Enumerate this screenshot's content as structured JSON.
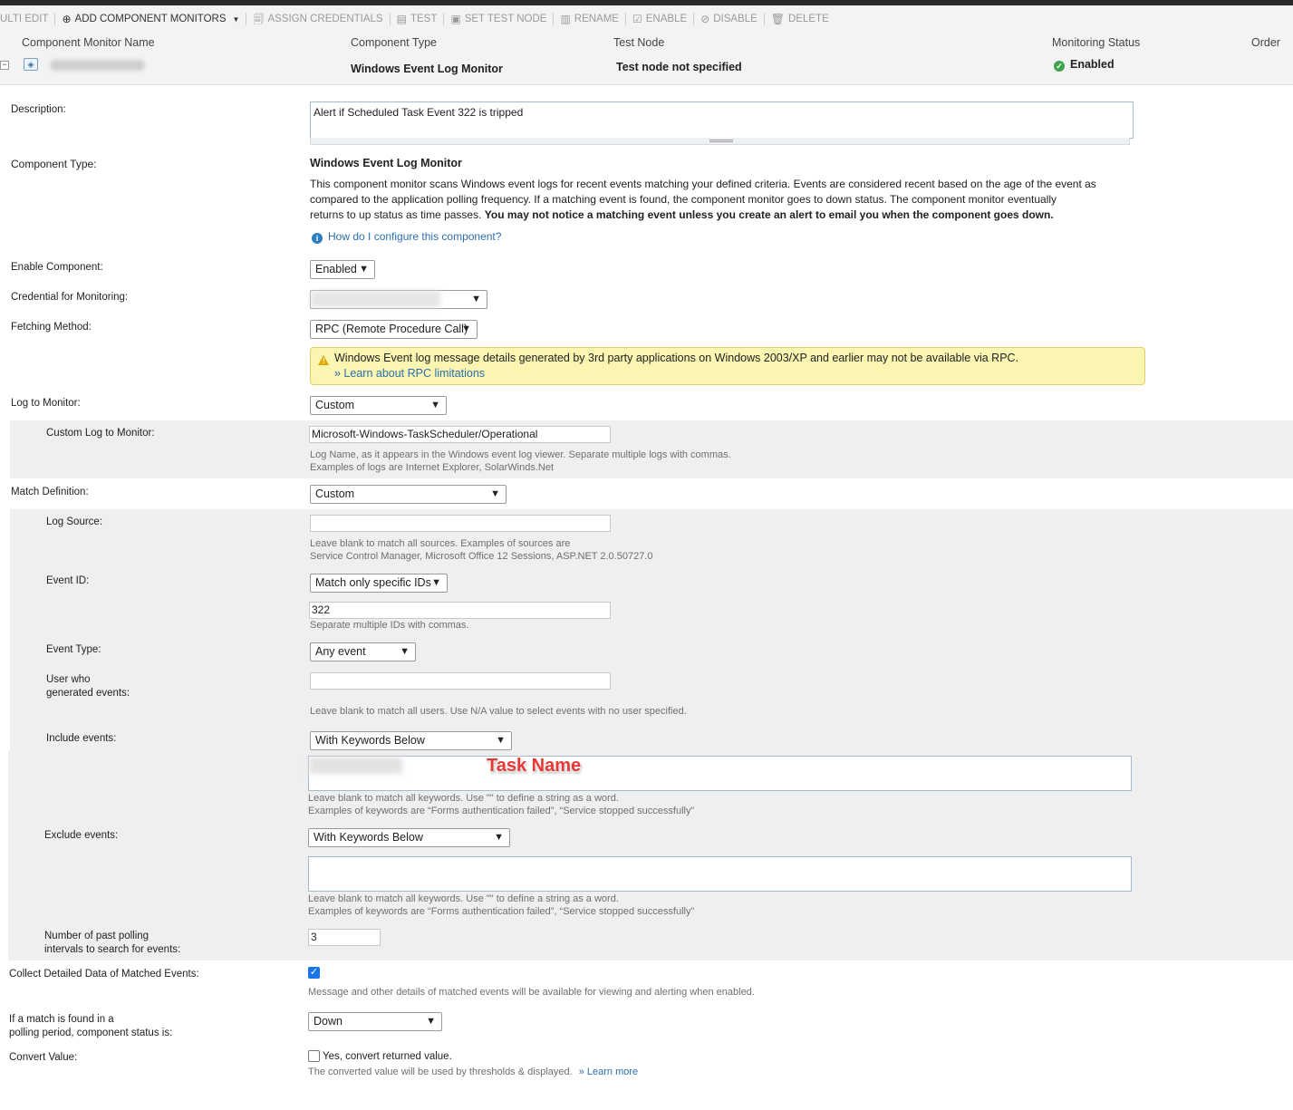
{
  "toolbar": {
    "multi_edit": "ULTI EDIT",
    "add_component_monitors": "ADD COMPONENT MONITORS",
    "assign_credentials": "ASSIGN CREDENTIALS",
    "test": "TEST",
    "set_test_node": "SET TEST NODE",
    "rename": "RENAME",
    "enable": "ENABLE",
    "disable": "DISABLE",
    "delete": "DELETE"
  },
  "list": {
    "col_name": "Component Monitor Name",
    "col_type": "Component Type",
    "col_test_node": "Test Node",
    "col_status": "Monitoring Status",
    "col_order": "Order",
    "row": {
      "type": "Windows Event Log Monitor",
      "test_node": "Test node not specified",
      "status": "Enabled"
    }
  },
  "form": {
    "description": {
      "label": "Description:",
      "value": "Alert if Scheduled Task Event 322 is tripped"
    },
    "component_type": {
      "label": "Component Type:",
      "name": "Windows Event Log Monitor",
      "desc_line1": "This component monitor scans Windows event logs for recent events matching your defined criteria. Events are considered recent based on the age of the event as",
      "desc_line2": "compared to the application polling frequency. If a matching event is found, the component monitor goes to down status. The component monitor eventually",
      "desc_line3": "returns to up status as time passes.",
      "desc_bold": "You may not notice a matching event unless you create an alert to email you when the component goes down.",
      "help_link": "How do I configure this component?"
    },
    "enable_component": {
      "label": "Enable Component:",
      "value": "Enabled"
    },
    "credential": {
      "label": "Credential for Monitoring:"
    },
    "fetching_method": {
      "label": "Fetching Method:",
      "value": "RPC (Remote Procedure Call)",
      "warning": "Windows Event log message details generated by 3rd party applications on Windows 2003/XP and earlier may not be available via RPC.",
      "warning_link": "» Learn about RPC limitations"
    },
    "log_to_monitor": {
      "label": "Log to Monitor:",
      "value": "Custom"
    },
    "custom_log": {
      "label": "Custom Log to Monitor:",
      "value": "Microsoft-Windows-TaskScheduler/Operational",
      "hint1": "Log Name, as it appears in the Windows event log viewer. Separate multiple logs with commas.",
      "hint2": "Examples of logs are Internet Explorer, SolarWinds.Net"
    },
    "match_definition": {
      "label": "Match Definition:",
      "value": "Custom"
    },
    "log_source": {
      "label": "Log Source:",
      "value": "",
      "hint1": "Leave blank to match all sources. Examples of sources are",
      "hint2": "Service Control Manager, Microsoft Office 12 Sessions, ASP.NET 2.0.50727.0"
    },
    "event_id": {
      "label": "Event ID:",
      "mode": "Match only specific IDs",
      "value": "322",
      "hint": "Separate multiple IDs with commas."
    },
    "event_type": {
      "label": "Event Type:",
      "value": "Any event"
    },
    "user": {
      "label1": "User who",
      "label2": "generated events:",
      "value": "",
      "hint": "Leave blank to match all users. Use N/A value to select events with no user specified."
    },
    "include_events": {
      "label": "Include events:",
      "mode": "With Keywords Below",
      "annotation": "Task Name",
      "hint1": "Leave blank to match all keywords. Use \"\" to define a string as a word.",
      "hint2": "Examples of keywords are “Forms authentication failed”, “Service stopped successfully”"
    },
    "exclude_events": {
      "label": "Exclude events:",
      "mode": "With Keywords Below",
      "hint1": "Leave blank to match all keywords. Use \"\" to define a string as a word.",
      "hint2": "Examples of keywords are “Forms authentication failed”, “Service stopped successfully”"
    },
    "past_intervals": {
      "label1": "Number of past polling",
      "label2": "intervals to search for events:",
      "value": "3"
    },
    "collect_detailed": {
      "label": "Collect Detailed Data of Matched Events:",
      "checked": true,
      "hint": "Message and other details of matched events will be available for viewing and alerting when enabled."
    },
    "match_status": {
      "label1": "If a match is found in a",
      "label2": "polling period, component status is:",
      "value": "Down"
    },
    "convert_value": {
      "label": "Convert Value:",
      "checkbox_label": "Yes, convert returned value.",
      "checked": false,
      "hint": "The converted value will be used by thresholds & displayed.",
      "link": "» Learn more"
    }
  }
}
